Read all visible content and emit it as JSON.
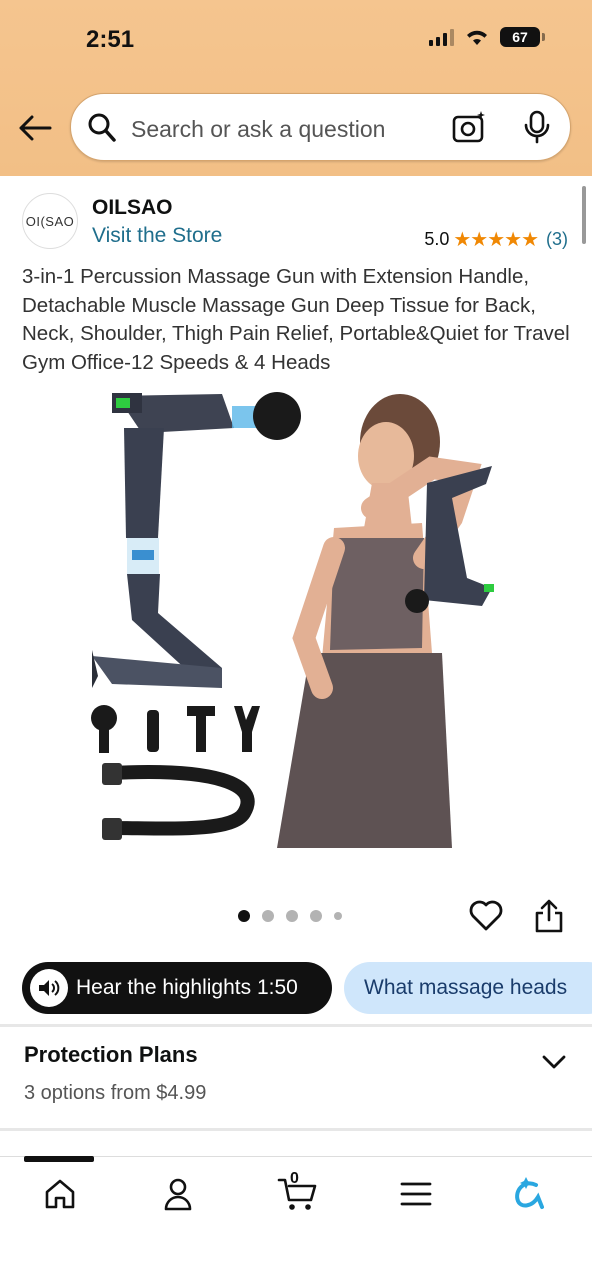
{
  "status": {
    "time": "2:51",
    "battery": "67"
  },
  "search": {
    "placeholder": "Search or ask a question"
  },
  "brand": {
    "logo_text": "OI(SAO",
    "name": "OILSAO",
    "store_link": "Visit the Store"
  },
  "rating": {
    "score": "5.0",
    "stars": "★★★★★",
    "count": "(3)"
  },
  "product": {
    "title": "3-in-1 Percussion Massage Gun with Extension Handle, Detachable Muscle Massage Gun Deep Tissue for Back, Neck, Shoulder, Thigh Pain Relief, Portable&Quiet for Travel Gym Office-12 Speeds & 4 Heads",
    "image_count": 5,
    "current_image": 1
  },
  "actions": {
    "hear_highlights": "Hear the highlights 1:50",
    "question_chip": "What massage heads"
  },
  "protection": {
    "title": "Protection Plans",
    "subtitle": "3 options from $4.99"
  },
  "nav": {
    "cart_count": "0",
    "items": [
      "home-icon",
      "account-icon",
      "cart-icon",
      "menu-icon",
      "rufus-icon"
    ]
  },
  "colors": {
    "header": "#f5c58f",
    "link": "#1f6e8c",
    "star": "#f08804",
    "chip_blue": "#cfe6fb"
  }
}
